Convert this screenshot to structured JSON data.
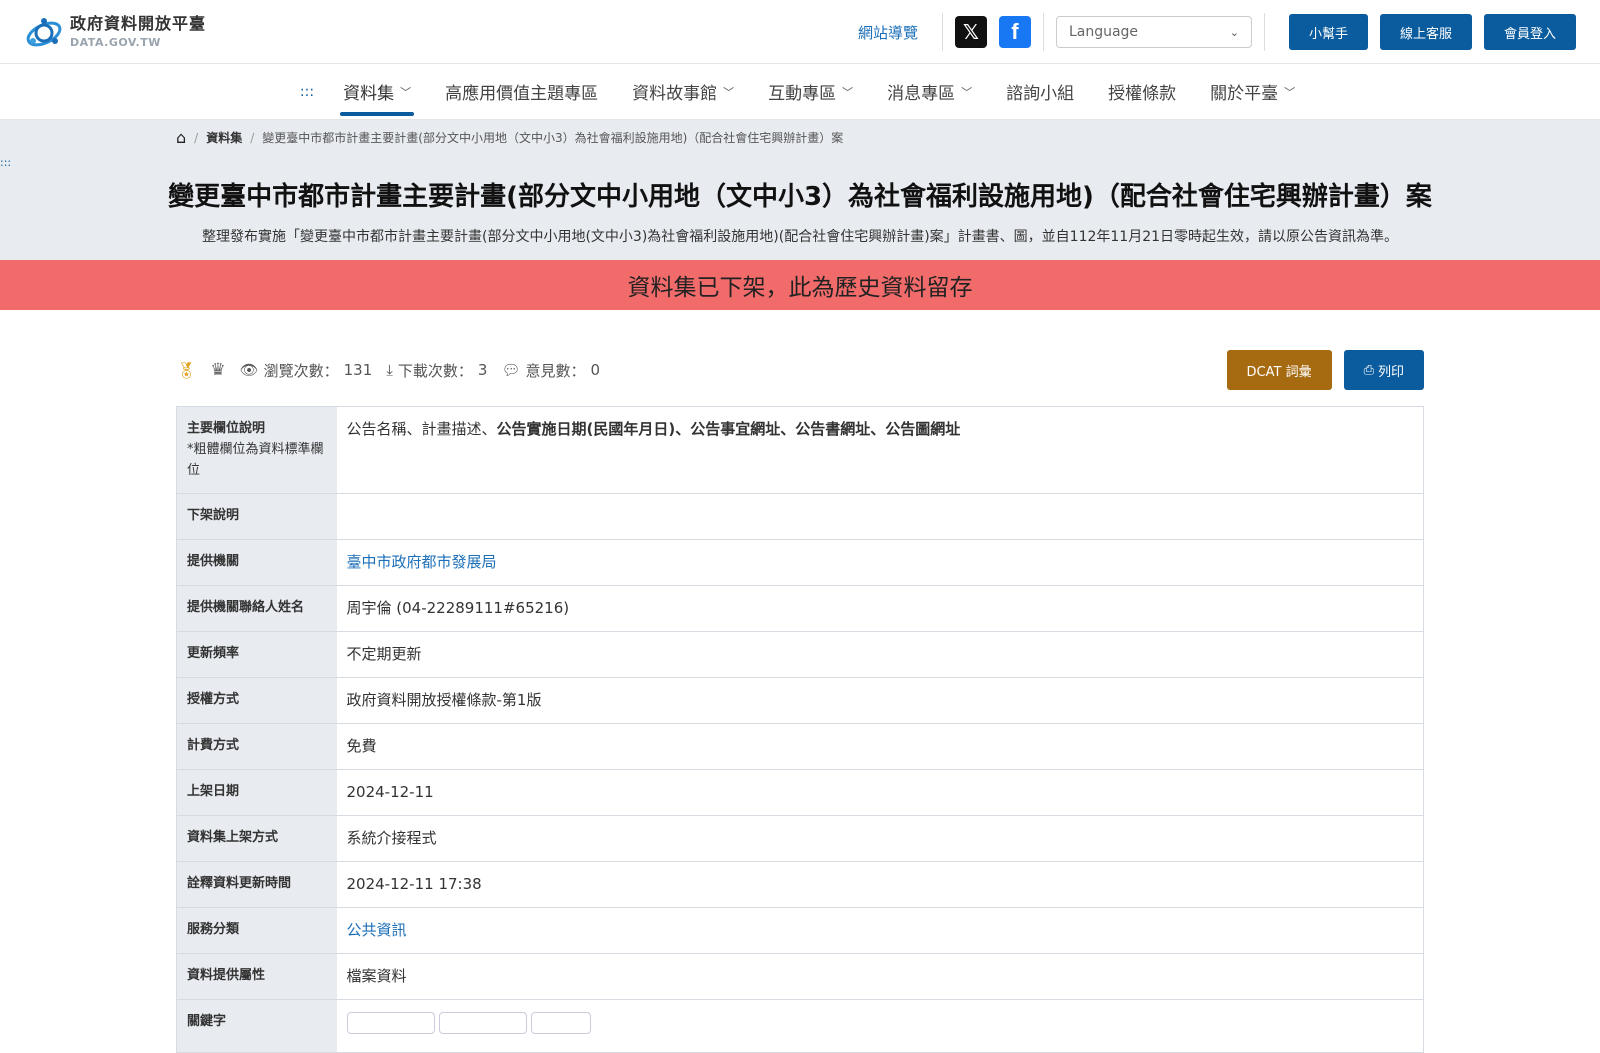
{
  "header": {
    "logo_cn": "政府資料開放平臺",
    "logo_en": "DATA.GOV.TW",
    "sitemap": "網站導覽",
    "language_placeholder": "Language",
    "btn_helper": "小幫手",
    "btn_service": "線上客服",
    "btn_login": "會員登入"
  },
  "nav": {
    "accesskey": ":::",
    "items": [
      "資料集",
      "高應用價值主題專區",
      "資料故事館",
      "互動專區",
      "消息專區",
      "諮詢小組",
      "授權條款",
      "關於平臺"
    ]
  },
  "breadcrumb": {
    "level1": "資料集",
    "current": "變更臺中市都市計畫主要計畫(部分文中小用地（文中小3）為社會福利設施用地)（配合社會住宅興辦計畫）案"
  },
  "hero": {
    "accesskey": ":::",
    "title": "變更臺中市都市計畫主要計畫(部分文中小用地（文中小3）為社會福利設施用地)（配合社會住宅興辦計畫）案",
    "description": "整理發布實施「變更臺中市都市計畫主要計畫(部分文中小用地(文中小3)為社會福利設施用地)(配合社會住宅興辦計畫)案」計畫書、圖，並自112年11月21日零時起生效，請以原公告資訊為準。"
  },
  "banner": "資料集已下架，此為歷史資料留存",
  "stats": {
    "views_label": "瀏覽次數：",
    "views": "131",
    "downloads_label": "下載次數：",
    "downloads": "3",
    "comments_label": "意見數：",
    "comments": "0",
    "btn_dcat": "DCAT 詞彙",
    "btn_print": "列印"
  },
  "table": {
    "main_fields_label": "主要欄位說明",
    "main_fields_note": "*粗體欄位為資料標準欄位",
    "main_fields_plain": "公告名稱、計畫描述、",
    "main_fields_bold": "公告實施日期(民國年月日)、公告事宜網址、公告書網址、公告圖網址",
    "offline_label": "下架說明",
    "offline_value": "",
    "provider_label": "提供機關",
    "provider_value": "臺中市政府都市發展局",
    "contact_label": "提供機關聯絡人姓名",
    "contact_value": "周宇倫 (04-22289111#65216)",
    "frequency_label": "更新頻率",
    "frequency_value": "不定期更新",
    "license_label": "授權方式",
    "license_value": "政府資料開放授權條款-第1版",
    "fee_label": "計費方式",
    "fee_value": "免費",
    "publish_label": "上架日期",
    "publish_value": "2024-12-11",
    "method_label": "資料集上架方式",
    "method_value": "系統介接程式",
    "meta_update_label": "詮釋資料更新時間",
    "meta_update_value": "2024-12-11 17:38",
    "category_label": "服務分類",
    "category_value": "公共資訊",
    "attr_label": "資料提供屬性",
    "attr_value": "檔案資料",
    "keyword_label": "關鍵字"
  },
  "colors": {
    "primary": "#0b5c9e",
    "banner": "#f26b6b",
    "dcat": "#a66a10",
    "hero_bg": "#e8ecf1"
  }
}
